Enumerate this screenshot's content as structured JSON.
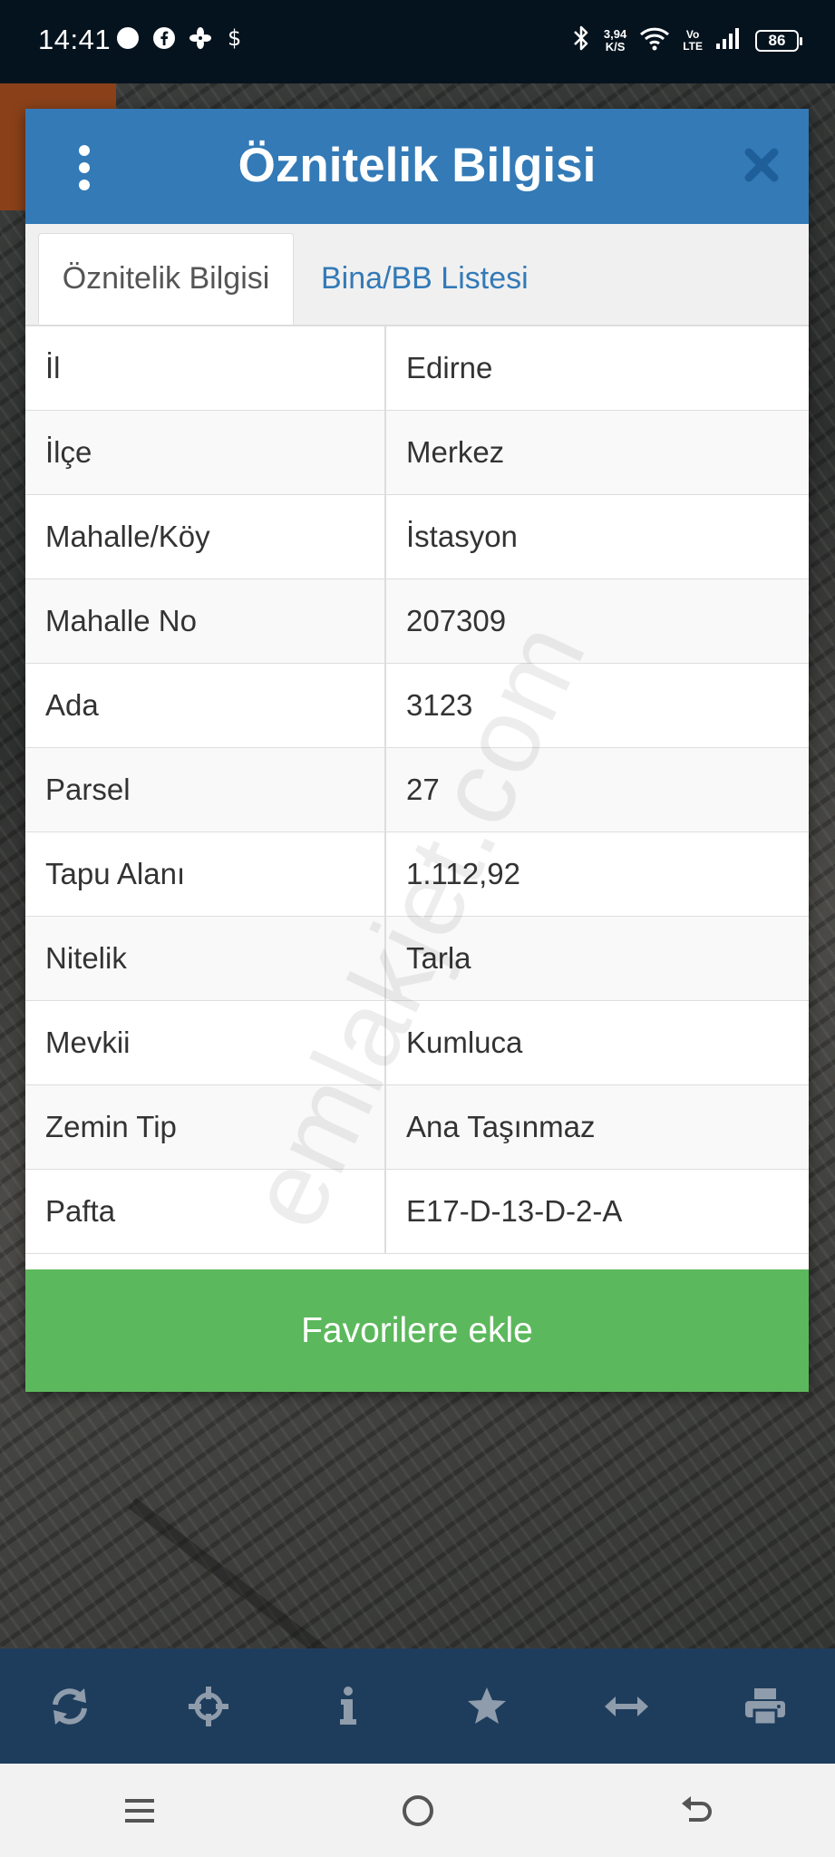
{
  "status_bar": {
    "time": "14:41",
    "speed_value": "3,94",
    "speed_unit": "K/S",
    "volte_top": "Vo",
    "volte_bottom": "LTE",
    "battery": "86"
  },
  "dialog": {
    "title": "Öznitelik Bilgisi",
    "tabs": [
      {
        "label": "Öznitelik Bilgisi",
        "active": true
      },
      {
        "label": "Bina/BB Listesi",
        "active": false
      }
    ],
    "rows": [
      {
        "key": "İl",
        "value": "Edirne"
      },
      {
        "key": "İlçe",
        "value": "Merkez"
      },
      {
        "key": "Mahalle/Köy",
        "value": "İstasyon"
      },
      {
        "key": "Mahalle No",
        "value": "207309"
      },
      {
        "key": "Ada",
        "value": "3123"
      },
      {
        "key": "Parsel",
        "value": "27"
      },
      {
        "key": "Tapu Alanı",
        "value": "1.112,92"
      },
      {
        "key": "Nitelik",
        "value": "Tarla"
      },
      {
        "key": "Mevkii",
        "value": "Kumluca"
      },
      {
        "key": "Zemin Tip",
        "value": "Ana Taşınmaz"
      },
      {
        "key": "Pafta",
        "value": "E17-D-13-D-2-A"
      }
    ],
    "favorite_button": "Favorilere ekle"
  },
  "watermark": "emlakjet.com",
  "toolbar_icons": [
    "refresh-icon",
    "crosshair-icon",
    "info-icon",
    "star-icon",
    "measure-icon",
    "print-icon"
  ],
  "colors": {
    "header": "#337ab7",
    "favorite_button": "#5cb85c",
    "toolbar": "#1e3d5c",
    "toolbar_icon": "#8f9cab",
    "status_bar": "#05131e"
  }
}
